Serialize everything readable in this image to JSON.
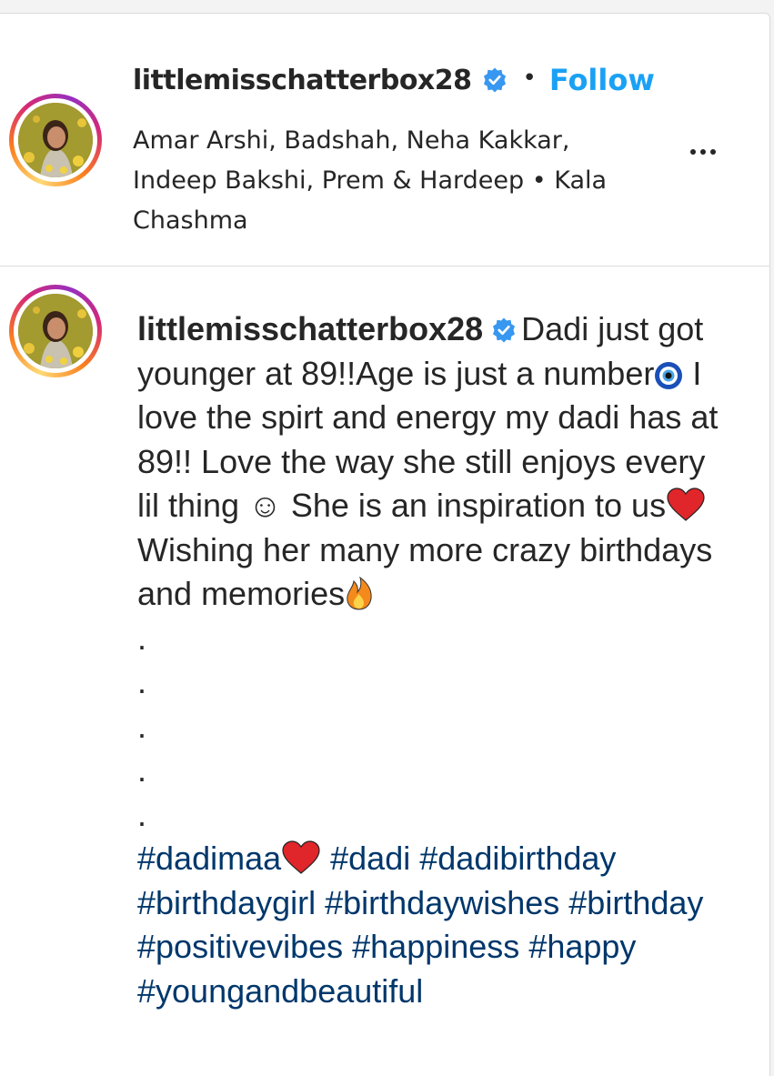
{
  "header": {
    "username": "littlemisschatterbox28",
    "separator": "•",
    "follow_label": "Follow",
    "audio_line": "Amar Arshi, Badshah, Neha Kakkar, Indeep Bakshi, Prem & Hardeep • Kala Chashma",
    "more_icon": "more-horizontal-icon"
  },
  "caption": {
    "username": "littlemisschatterbox28",
    "text_1": "Dadi just got younger at 89!!Age is just a number",
    "text_2": " I love the spirt and energy my dadi has at 89!! Love the way she still enjoys every lil thing ☺ She is an inspiration to us",
    "text_3": "Wishing her many more crazy birthdays and memories",
    "dots": [
      ".",
      ".",
      ".",
      ".",
      "."
    ],
    "hashtags": {
      "h1": "#dadimaa",
      "h2": "#dadi",
      "h3": "#dadibirthday",
      "h4": "#birthdaygirl",
      "h5": "#birthdaywishes",
      "h6": "#birthday",
      "h7": "#positivevibes",
      "h8": "#happiness",
      "h9": "#happy",
      "h10": "#youngandbeautiful"
    }
  },
  "colors": {
    "follow": "#1aa1f5",
    "verified": "#3897f0",
    "hashtag": "#00376b",
    "text": "#262626"
  }
}
